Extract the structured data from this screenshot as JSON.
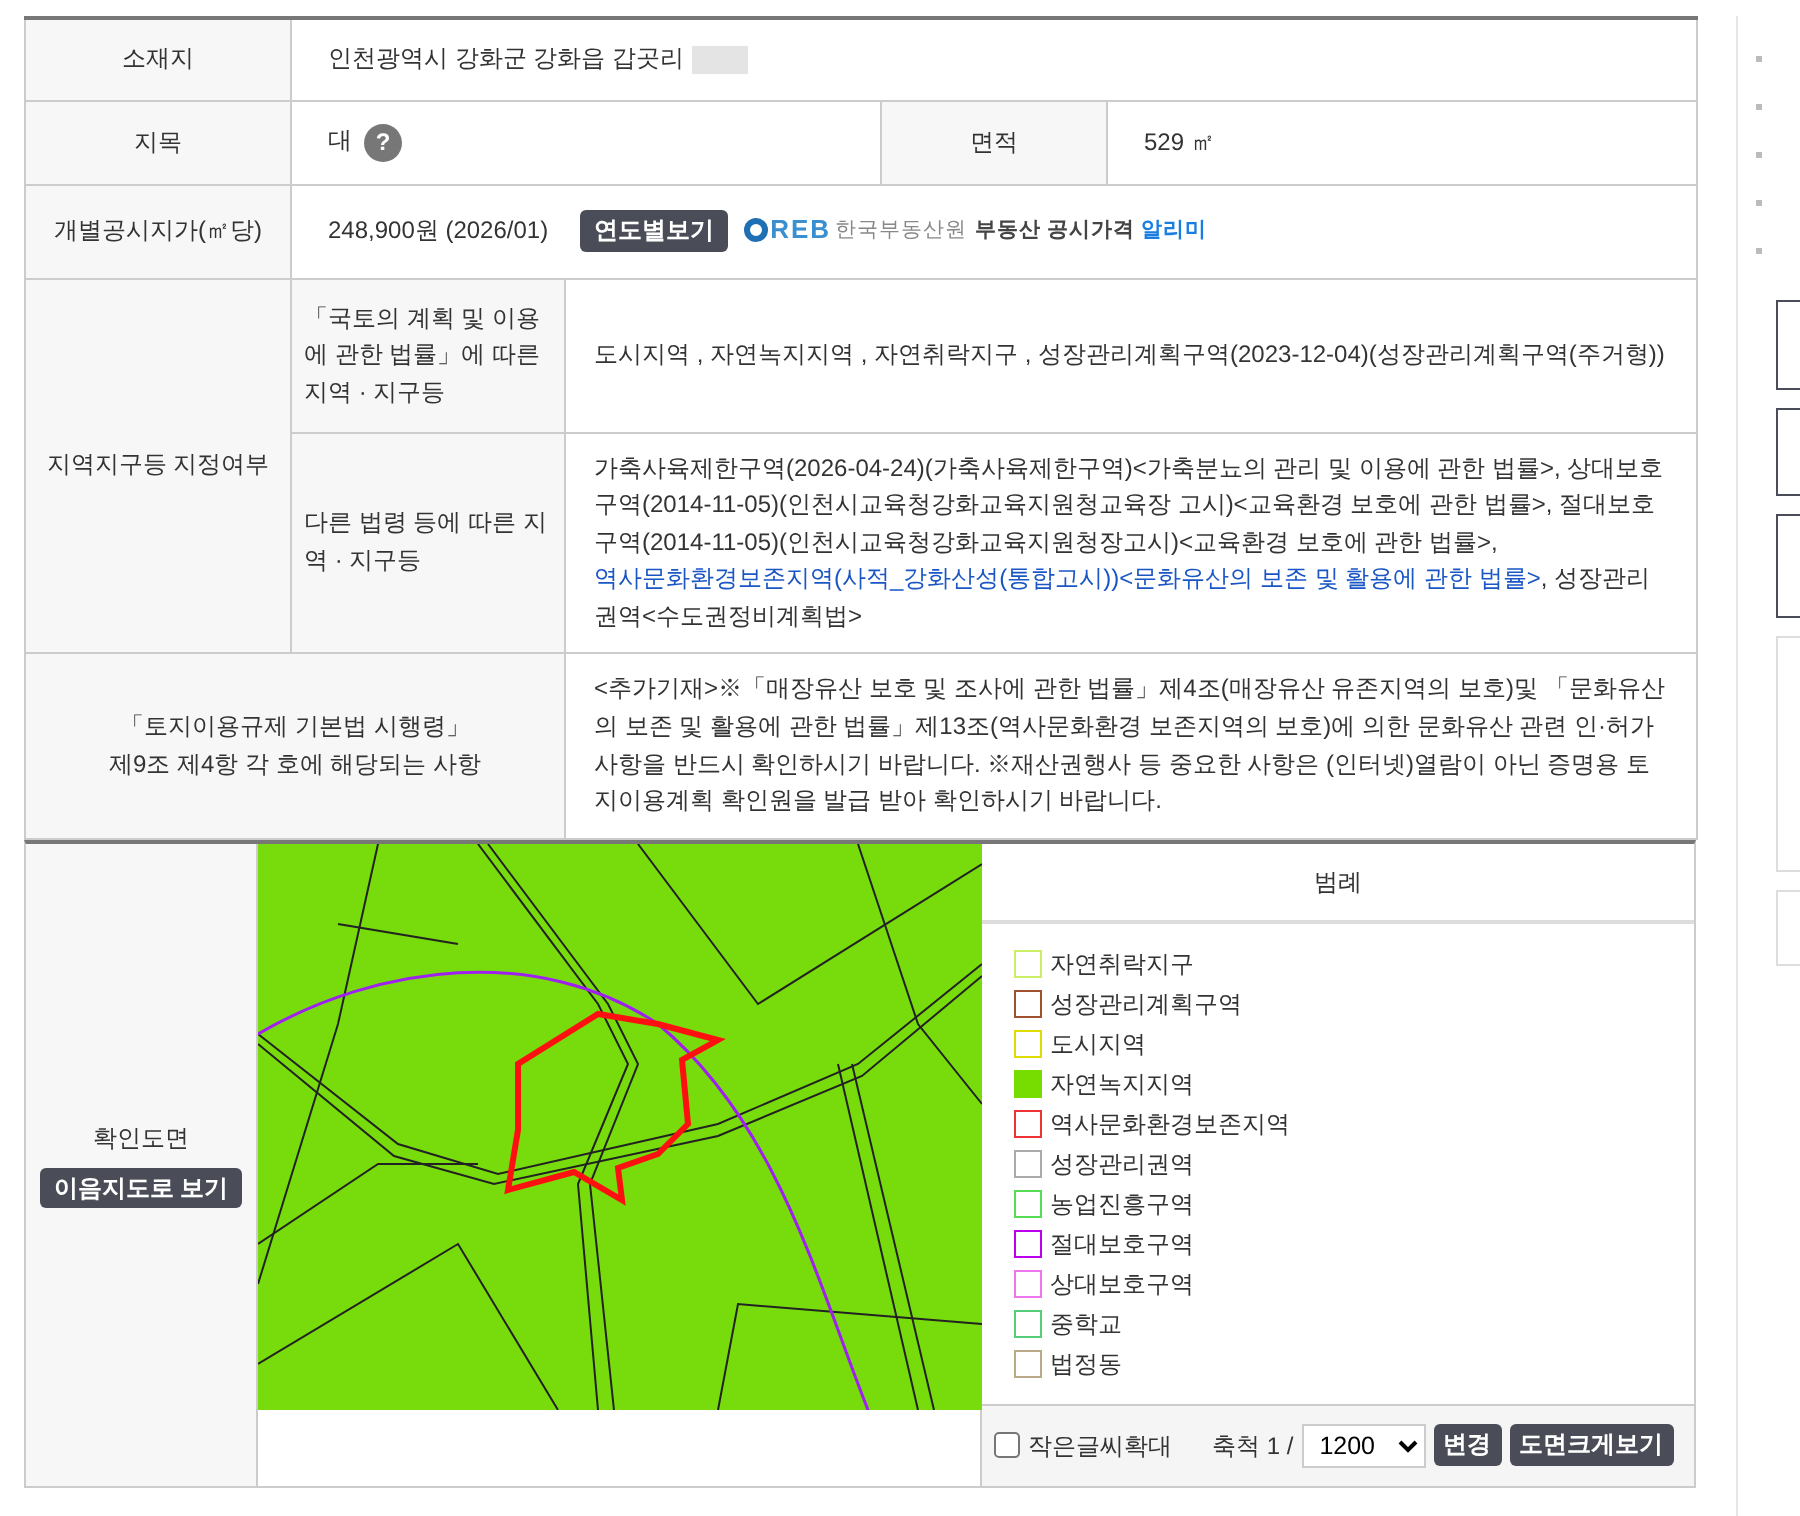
{
  "location": {
    "label": "소재지",
    "value": "인천광역시 강화군 강화읍 갑곳리"
  },
  "land_category": {
    "label": "지목",
    "value": "대",
    "help": "?"
  },
  "area": {
    "label": "면적",
    "value": "529 ㎡"
  },
  "price": {
    "label": "개별공시지가(㎡당)",
    "value": "248,900원 (2026/01)",
    "button": "연도별보기",
    "logo": "REB",
    "agency": "한국부동산원",
    "service": "부동산 공시가격",
    "service_link": "알리미"
  },
  "zones": {
    "label": "지역지구등 지정여부",
    "groups": [
      {
        "label": "「국토의 계획 및 이용에 관한 법률」에 따른 지역 · 지구등",
        "segments": [
          {
            "text": "도시지역 , 자연녹지지역 , 자연취락지구 , 성장관리계획구역(2023-12-04)(성장관리계획구역(주거형))",
            "link": false
          }
        ]
      },
      {
        "label": "다른 법령 등에 따른 지역 · 지구등",
        "segments": [
          {
            "text": "가축사육제한구역(2026-04-24)(가축사육제한구역)<가축분뇨의 관리 및 이용에 관한 법률>, 상대보호구역(2014-11-05)(인천시교육청강화교육지원청교육장 고시)<교육환경 보호에 관한 법률>, 절대보호구역(2014-11-05)(인천시교육청강화교육지원청장고시)<교육환경 보호에 관한 법률>, ",
            "link": false
          },
          {
            "text": "역사문화환경보존지역(사적_강화산성(통합고시))",
            "link": true
          },
          {
            "text": "<문화유산의 보존 및 활용에 관한 법률>",
            "link": true
          },
          {
            "text": ", 성장관리권역<수도권정비계획법>",
            "link": false
          }
        ]
      }
    ]
  },
  "notice": {
    "label_lines": [
      "「토지이용규제 기본법 시행령」",
      "제9조 제4항 각 호에 해당되는 사항"
    ],
    "text": "<추가기재>※「매장유산 보호 및 조사에 관한 법률」제4조(매장유산 유존지역의 보호)및 「문화유산의 보존 및 활용에 관한 법률」제13조(역사문화환경 보존지역의 보호)에 의한 문화유산 관련 인·허가 사항을 반드시 확인하시기 바랍니다. ※재산권행사 등 중요한 사항은 (인터넷)열람이 아닌 증명용 토지이용계획 확인원을 발급 받아 확인하시기 바랍니다."
  },
  "map": {
    "label": "확인도면",
    "button": "이음지도로 보기",
    "legend_title": "범례",
    "legend": [
      {
        "label": "자연취락지구",
        "color": "#ccee66",
        "filled": false
      },
      {
        "label": "성장관리계획구역",
        "color": "#a0522d",
        "filled": false
      },
      {
        "label": "도시지역",
        "color": "#dddd00",
        "filled": false
      },
      {
        "label": "자연녹지지역",
        "color": "#77dd00",
        "filled": true
      },
      {
        "label": "역사문화환경보존지역",
        "color": "#ee3333",
        "filled": false
      },
      {
        "label": "성장관리권역",
        "color": "#aaaaaa",
        "filled": false
      },
      {
        "label": "농업진흥구역",
        "color": "#55dd55",
        "filled": false
      },
      {
        "label": "절대보호구역",
        "color": "#bb00ee",
        "filled": false
      },
      {
        "label": "상대보호구역",
        "color": "#ee77ee",
        "filled": false
      },
      {
        "label": "중학교",
        "color": "#55cc77",
        "filled": false
      },
      {
        "label": "법정동",
        "color": "#bbaa88",
        "filled": false
      }
    ],
    "enlarge": {
      "label": "작은글씨확대",
      "checked": false
    },
    "scale_label": "축척 1 /",
    "scale": "1200",
    "buttons": [
      "변경",
      "도면크게보기"
    ]
  }
}
